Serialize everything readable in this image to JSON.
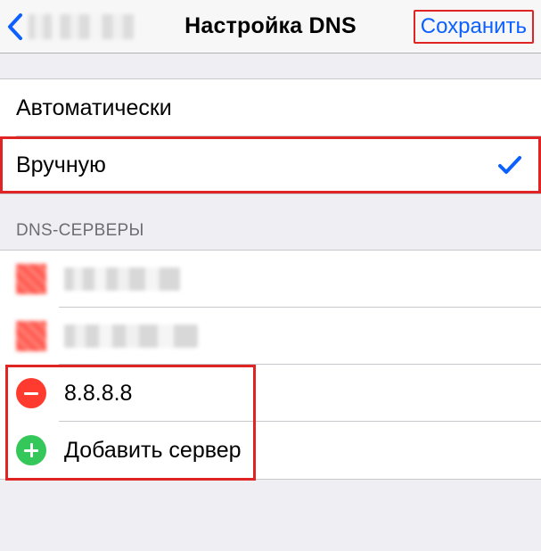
{
  "header": {
    "title": "Настройка DNS",
    "save_label": "Сохранить"
  },
  "mode": {
    "automatic_label": "Автоматически",
    "manual_label": "Вручную"
  },
  "servers": {
    "section_title": "DNS-СЕРВЕРЫ",
    "entries": [
      {
        "ip": "8.8.8.8"
      }
    ],
    "add_label": "Добавить сервер"
  }
}
